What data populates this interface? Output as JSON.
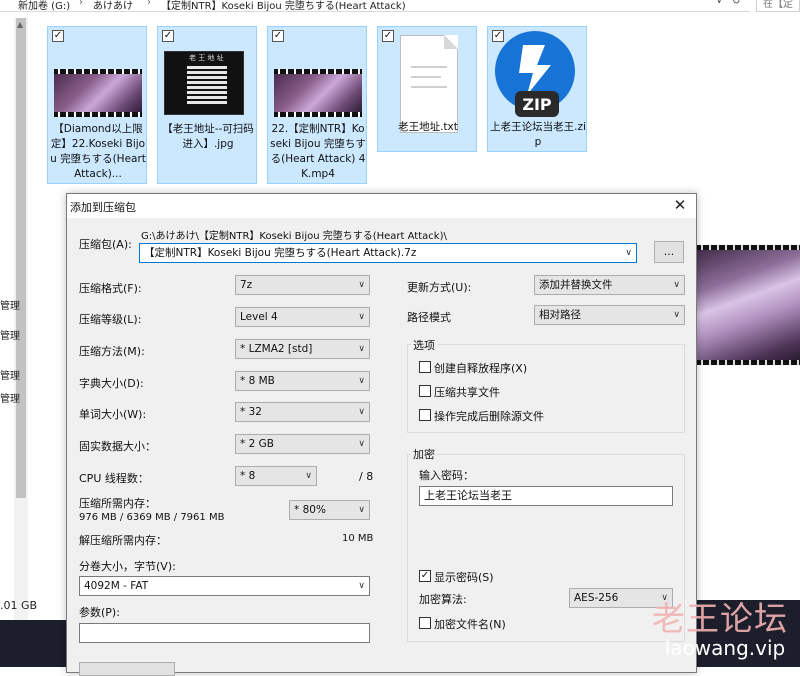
{
  "explorer": {
    "breadcrumbs": [
      "新加卷 (G:)",
      "あけあけ",
      "【定制NTR】Koseki Bijou 完堕ちする(Heart Attack)"
    ],
    "search_placeholder": "在【定",
    "left_items": [
      "管理",
      "管理",
      "管理",
      "管理"
    ],
    "free_space": ".01 GB",
    "files": [
      {
        "name": "【Diamond以上限定】22.Koseki Bijou 完堕ちする(Heart Attack)...",
        "checked": "✓",
        "kind": "video"
      },
      {
        "name": "【老王地址--可扫码进入】.jpg",
        "checked": "✓",
        "kind": "qr"
      },
      {
        "name": "22.【定制NTR】Koseki Bijou 完堕ちする(Heart Attack) 4K.mp4",
        "checked": "✓",
        "kind": "video"
      },
      {
        "name": "老王地址.txt",
        "checked": "✓",
        "kind": "text"
      },
      {
        "name": "上老王论坛当老王.zip",
        "checked": "✓",
        "kind": "zip"
      }
    ],
    "zip_label": "ZIP",
    "qr_caption": "老 王 地 址",
    "watermark": "老王论坛",
    "watermark_url": "laowang.vip"
  },
  "dialog": {
    "title": "添加到压缩包",
    "archive_label": "压缩包(A):",
    "archive_path": "G:\\あけあけ\\【定制NTR】Koseki Bijou 完堕ちする(Heart Attack)\\",
    "archive_name": "【定制NTR】Koseki Bijou 完堕ちする(Heart Attack).7z",
    "browse_label": "...",
    "format_label": "压缩格式(F):",
    "format_value": "7z",
    "level_label": "压缩等级(L):",
    "level_value": "Level 4",
    "method_label": "压缩方法(M):",
    "method_value": "* LZMA2 [std]",
    "dict_label": "字典大小(D):",
    "dict_value": "* 8 MB",
    "word_label": "单词大小(W):",
    "word_value": "* 32",
    "solid_label": "固实数据大小：",
    "solid_value": "* 2 GB",
    "threads_label": "CPU 线程数：",
    "threads_value": "* 8",
    "threads_max": "/ 8",
    "mem_label": "压缩所需内存：",
    "mem_value": "976 MB / 6369 MB / 7961 MB",
    "mem_percent": "* 80%",
    "decomp_label": "解压缩所需内存：",
    "decomp_value": "10 MB",
    "split_label": "分卷大小，字节(V):",
    "split_value": "4092M - FAT",
    "params_label": "参数(P):",
    "params_value": "",
    "update_label": "更新方式(U):",
    "update_value": "添加并替换文件",
    "path_label": "路径模式",
    "path_value": "相对路径",
    "options_title": "选项",
    "opt_sfx": "创建自释放程序(X)",
    "opt_shared": "压缩共享文件",
    "opt_delete": "操作完成后删除源文件",
    "encrypt_title": "加密",
    "password_label": "输入密码：",
    "password_value": "上老王论坛当老王",
    "show_password": "显示密码(S)",
    "show_password_check": "✓",
    "encrypt_method_label": "加密算法:",
    "encrypt_method_value": "AES-256",
    "encrypt_names": "加密文件名(N)"
  }
}
